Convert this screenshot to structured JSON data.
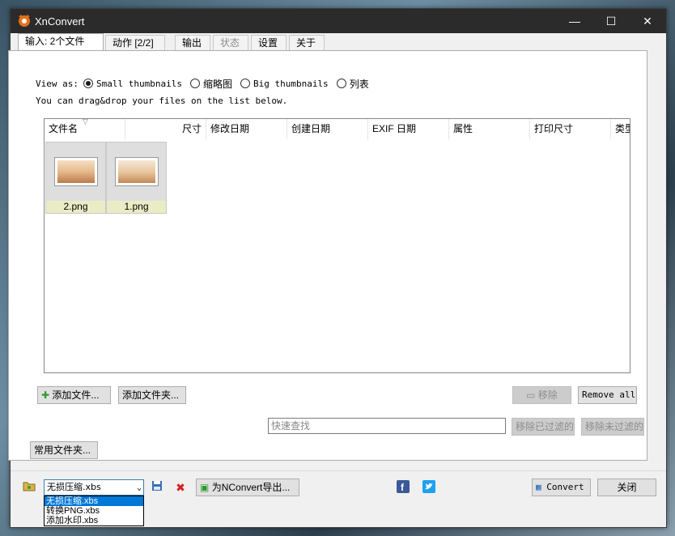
{
  "window": {
    "title": "XnConvert",
    "minimize": "—",
    "maximize": "☐",
    "close": "✕"
  },
  "tabs": [
    {
      "label": "输入: 2个文件"
    },
    {
      "label": "动作 [2/2]"
    },
    {
      "label": "输出"
    },
    {
      "label": "状态"
    },
    {
      "label": "设置"
    },
    {
      "label": "关于"
    }
  ],
  "view": {
    "label": "View as:",
    "options": [
      "Small thumbnails",
      "缩略图",
      "Big thumbnails",
      "列表"
    ],
    "selected": "Small thumbnails"
  },
  "hint": "You can drag&drop your files on the list below.",
  "columns": [
    "文件名",
    "尺寸",
    "修改日期",
    "创建日期",
    "EXIF 日期",
    "属性",
    "打印尺寸",
    "类型"
  ],
  "files": [
    {
      "name": "2.png"
    },
    {
      "name": "1.png"
    }
  ],
  "buttons": {
    "add_files": "添加文件...",
    "add_folder": "添加文件夹...",
    "remove": "移除",
    "remove_all": "Remove all",
    "remove_filtered": "移除已过滤的",
    "remove_unfiltered": "移除未过滤的",
    "common_folders": "常用文件夹...",
    "export_nconvert": "为NConvert导出...",
    "convert": "Convert",
    "close": "关闭"
  },
  "search": {
    "placeholder": "快速查找"
  },
  "preset": {
    "selected": "无损压缩.xbs",
    "options": [
      "无损压缩.xbs",
      "转换PNG.xbs",
      "添加水印.xbs"
    ]
  },
  "colors": {
    "titlebar": "#2b2b2b",
    "accent": "#0078d7",
    "caption_bg": "#eaecc6",
    "add_green": "#2e9b2e",
    "delete_red": "#d62020",
    "facebook": "#3b5998",
    "twitter": "#1da1f2"
  },
  "icons": {
    "app": "xnconvert-logo-icon",
    "folder": "folder-icon",
    "save": "save-icon",
    "delete": "delete-icon",
    "export": "export-icon",
    "facebook": "facebook-icon",
    "twitter": "twitter-icon",
    "convert": "convert-icon",
    "add": "plus-icon",
    "remove": "minus-icon"
  }
}
